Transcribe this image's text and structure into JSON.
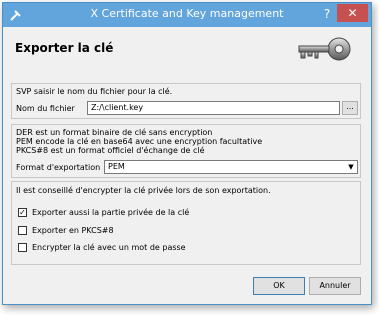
{
  "window": {
    "title": "X Certificate and Key management",
    "help_label": "?",
    "close_label": "✕"
  },
  "page": {
    "title": "Exporter la clé"
  },
  "filename_group": {
    "prompt": "SVP saisir le nom du fichier pour la clé.",
    "label": "Nom du fichier",
    "value": "Z:/\\client.key",
    "browse_label": "..."
  },
  "format_group": {
    "desc_lines": [
      "DER est un format binaire de clé sans encryption",
      "PEM encode la clé en base64 avec une encryption facultative",
      "PKCS#8 est un format officiel d'échange de clé"
    ],
    "label": "Format d'exportation",
    "selected": "PEM"
  },
  "options_group": {
    "advice": "Il est conseillé d'encrypter la clé privée lors de son exportation.",
    "checkboxes": [
      {
        "label": "Exporter aussi la partie privée de la clé",
        "checked": true,
        "mark": "✓"
      },
      {
        "label": "Exporter en PKCS#8",
        "checked": false,
        "mark": ""
      },
      {
        "label": "Encrypter la clé avec un mot de passe",
        "checked": false,
        "mark": ""
      }
    ]
  },
  "buttons": {
    "ok": "OK",
    "cancel": "Annuler"
  }
}
